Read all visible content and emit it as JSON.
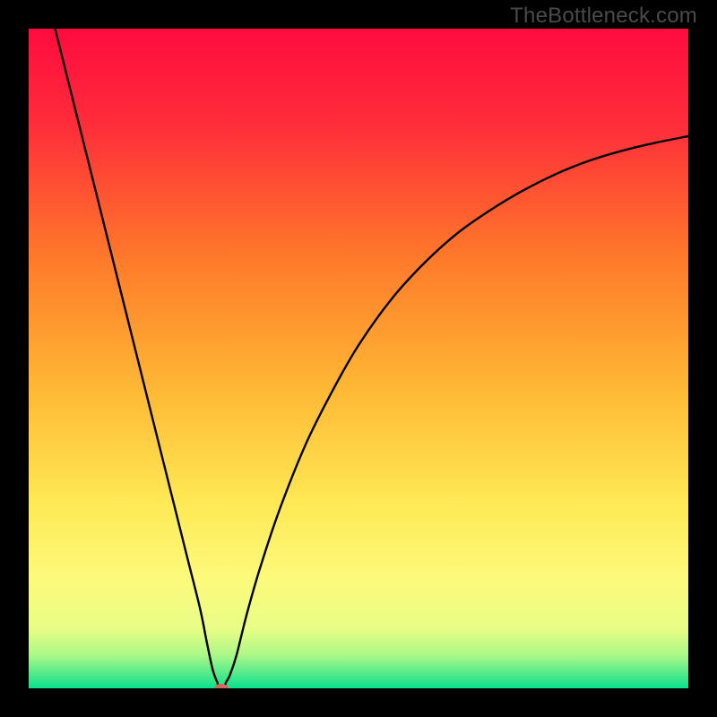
{
  "watermark": "TheBottleneck.com",
  "chart_data": {
    "type": "line",
    "title": "",
    "xlabel": "",
    "ylabel": "",
    "xlim": [
      0,
      100
    ],
    "ylim": [
      0,
      100
    ],
    "grid": false,
    "gradient_stops": [
      {
        "offset": 0,
        "color": "#ff0b3f"
      },
      {
        "offset": 15,
        "color": "#ff2e3a"
      },
      {
        "offset": 35,
        "color": "#ff7a2a"
      },
      {
        "offset": 55,
        "color": "#ffb935"
      },
      {
        "offset": 72,
        "color": "#ffe955"
      },
      {
        "offset": 83,
        "color": "#fdf97a"
      },
      {
        "offset": 91,
        "color": "#e9fd86"
      },
      {
        "offset": 95,
        "color": "#aaf887"
      },
      {
        "offset": 98,
        "color": "#4de98c"
      },
      {
        "offset": 100,
        "color": "#09e28d"
      }
    ],
    "series": [
      {
        "name": "curve",
        "x": [
          4,
          6,
          8,
          10,
          12,
          14,
          16,
          18,
          20,
          22,
          24,
          26,
          27,
          27.8,
          28.3,
          28.6,
          28.8,
          29.7,
          29.9,
          30.5,
          31.5,
          33,
          35,
          38,
          42,
          46,
          50,
          55,
          60,
          65,
          70,
          75,
          80,
          85,
          90,
          95,
          100
        ],
        "y": [
          100,
          92,
          84,
          76,
          68,
          60,
          52,
          44,
          36,
          28,
          20,
          12,
          7,
          3.2,
          1.6,
          0.9,
          0.4,
          0.4,
          0.9,
          2,
          5,
          11,
          18,
          27,
          37,
          45,
          52,
          59,
          64.5,
          69,
          72.5,
          75.5,
          78,
          80,
          81.5,
          82.7,
          83.7
        ]
      }
    ],
    "marker": {
      "x": 29.2,
      "y": 0,
      "color": "#d16a5e",
      "rx": 1.1,
      "ry": 0.7
    }
  }
}
